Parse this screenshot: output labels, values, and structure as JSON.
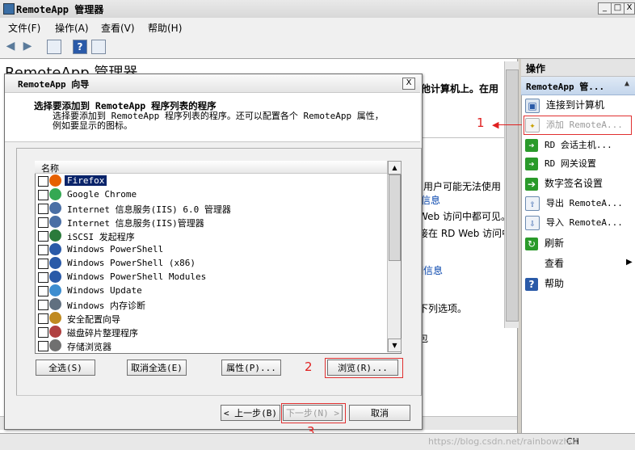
{
  "window": {
    "title": "RemoteApp 管理器",
    "min": "_",
    "max": "□",
    "close": "X"
  },
  "menu": [
    "文件(F)",
    "操作(A)",
    "查看(V)",
    "帮助(H)"
  ],
  "background": {
    "heading": "RemoteApp 管理器",
    "text_suffix": "他计算机上。在用",
    "lines": [
      "用户可能无法使用",
      "Web 访问中都可见。",
      "接在 RD Web 访问中",
      "下列选项。",
      "包"
    ],
    "links": [
      "信息",
      "细信息"
    ]
  },
  "actions_pane": {
    "header": "操作",
    "section": "RemoteApp 管...",
    "items": [
      {
        "label": "连接到计算机",
        "icon": "connect-computer-icon",
        "disabled": false
      },
      {
        "label": "添加 RemoteA...",
        "icon": "add-program-icon",
        "disabled": true
      },
      {
        "label": "RD 会话主机...",
        "icon": "green-arrow-icon",
        "disabled": false
      },
      {
        "label": "RD 网关设置",
        "icon": "green-arrow-icon",
        "disabled": false
      },
      {
        "label": "数字签名设置",
        "icon": "green-arrow-icon",
        "disabled": false
      },
      {
        "label": "导出 RemoteA...",
        "icon": "export-icon",
        "disabled": false
      },
      {
        "label": "导入 RemoteA...",
        "icon": "import-icon",
        "disabled": false
      },
      {
        "label": "刷新",
        "icon": "refresh-icon",
        "disabled": false
      },
      {
        "label": "查看",
        "icon": "",
        "disabled": false
      },
      {
        "label": "帮助",
        "icon": "help-icon",
        "disabled": false
      }
    ]
  },
  "dialog": {
    "title": "RemoteApp 向导",
    "close": "X",
    "heading": "选择要添加到 RemoteApp 程序列表的程序",
    "description": "选择要添加到 RemoteApp 程序列表的程序。还可以配置各个 RemoteApp 属性，例如要显示的图标。",
    "column_header": "名称",
    "programs": [
      {
        "name": "Firefox",
        "icon": "firefox-icon",
        "color": "#e66000",
        "selected": true
      },
      {
        "name": "Google Chrome",
        "icon": "chrome-icon",
        "color": "#34a853",
        "selected": false
      },
      {
        "name": "Internet 信息服务(IIS) 6.0 管理器",
        "icon": "iis-icon",
        "color": "#4a6fa5",
        "selected": false
      },
      {
        "name": "Internet 信息服务(IIS)管理器",
        "icon": "iis-icon",
        "color": "#4a6fa5",
        "selected": false
      },
      {
        "name": "iSCSI 发起程序",
        "icon": "iscsi-icon",
        "color": "#2b7a3b",
        "selected": false
      },
      {
        "name": "Windows PowerShell",
        "icon": "powershell-icon",
        "color": "#2a5aa8",
        "selected": false
      },
      {
        "name": "Windows PowerShell (x86)",
        "icon": "powershell-icon",
        "color": "#2a5aa8",
        "selected": false
      },
      {
        "name": "Windows PowerShell Modules",
        "icon": "powershell-icon",
        "color": "#2a5aa8",
        "selected": false
      },
      {
        "name": "Windows Update",
        "icon": "windows-update-icon",
        "color": "#3c8dd0",
        "selected": false
      },
      {
        "name": "Windows 内存诊断",
        "icon": "memory-diagnostic-icon",
        "color": "#607080",
        "selected": false
      },
      {
        "name": "安全配置向导",
        "icon": "security-wizard-icon",
        "color": "#c08a20",
        "selected": false
      },
      {
        "name": "磁盘碎片整理程序",
        "icon": "defrag-icon",
        "color": "#b04040",
        "selected": false
      },
      {
        "name": "存储浏览器",
        "icon": "storage-explorer-icon",
        "color": "#707070",
        "selected": false
      }
    ],
    "buttons": {
      "select_all": "全选(S)",
      "deselect_all": "取消全选(E)",
      "properties": "属性(P)...",
      "browse": "浏览(R)...",
      "back": "< 上一步(B)",
      "next": "下一步(N) >",
      "cancel": "取消"
    }
  },
  "annotations": [
    "1",
    "2",
    "3"
  ],
  "status": {
    "text": "CH"
  },
  "watermark": "https://blog.csdn.net/rainbowzhuf"
}
